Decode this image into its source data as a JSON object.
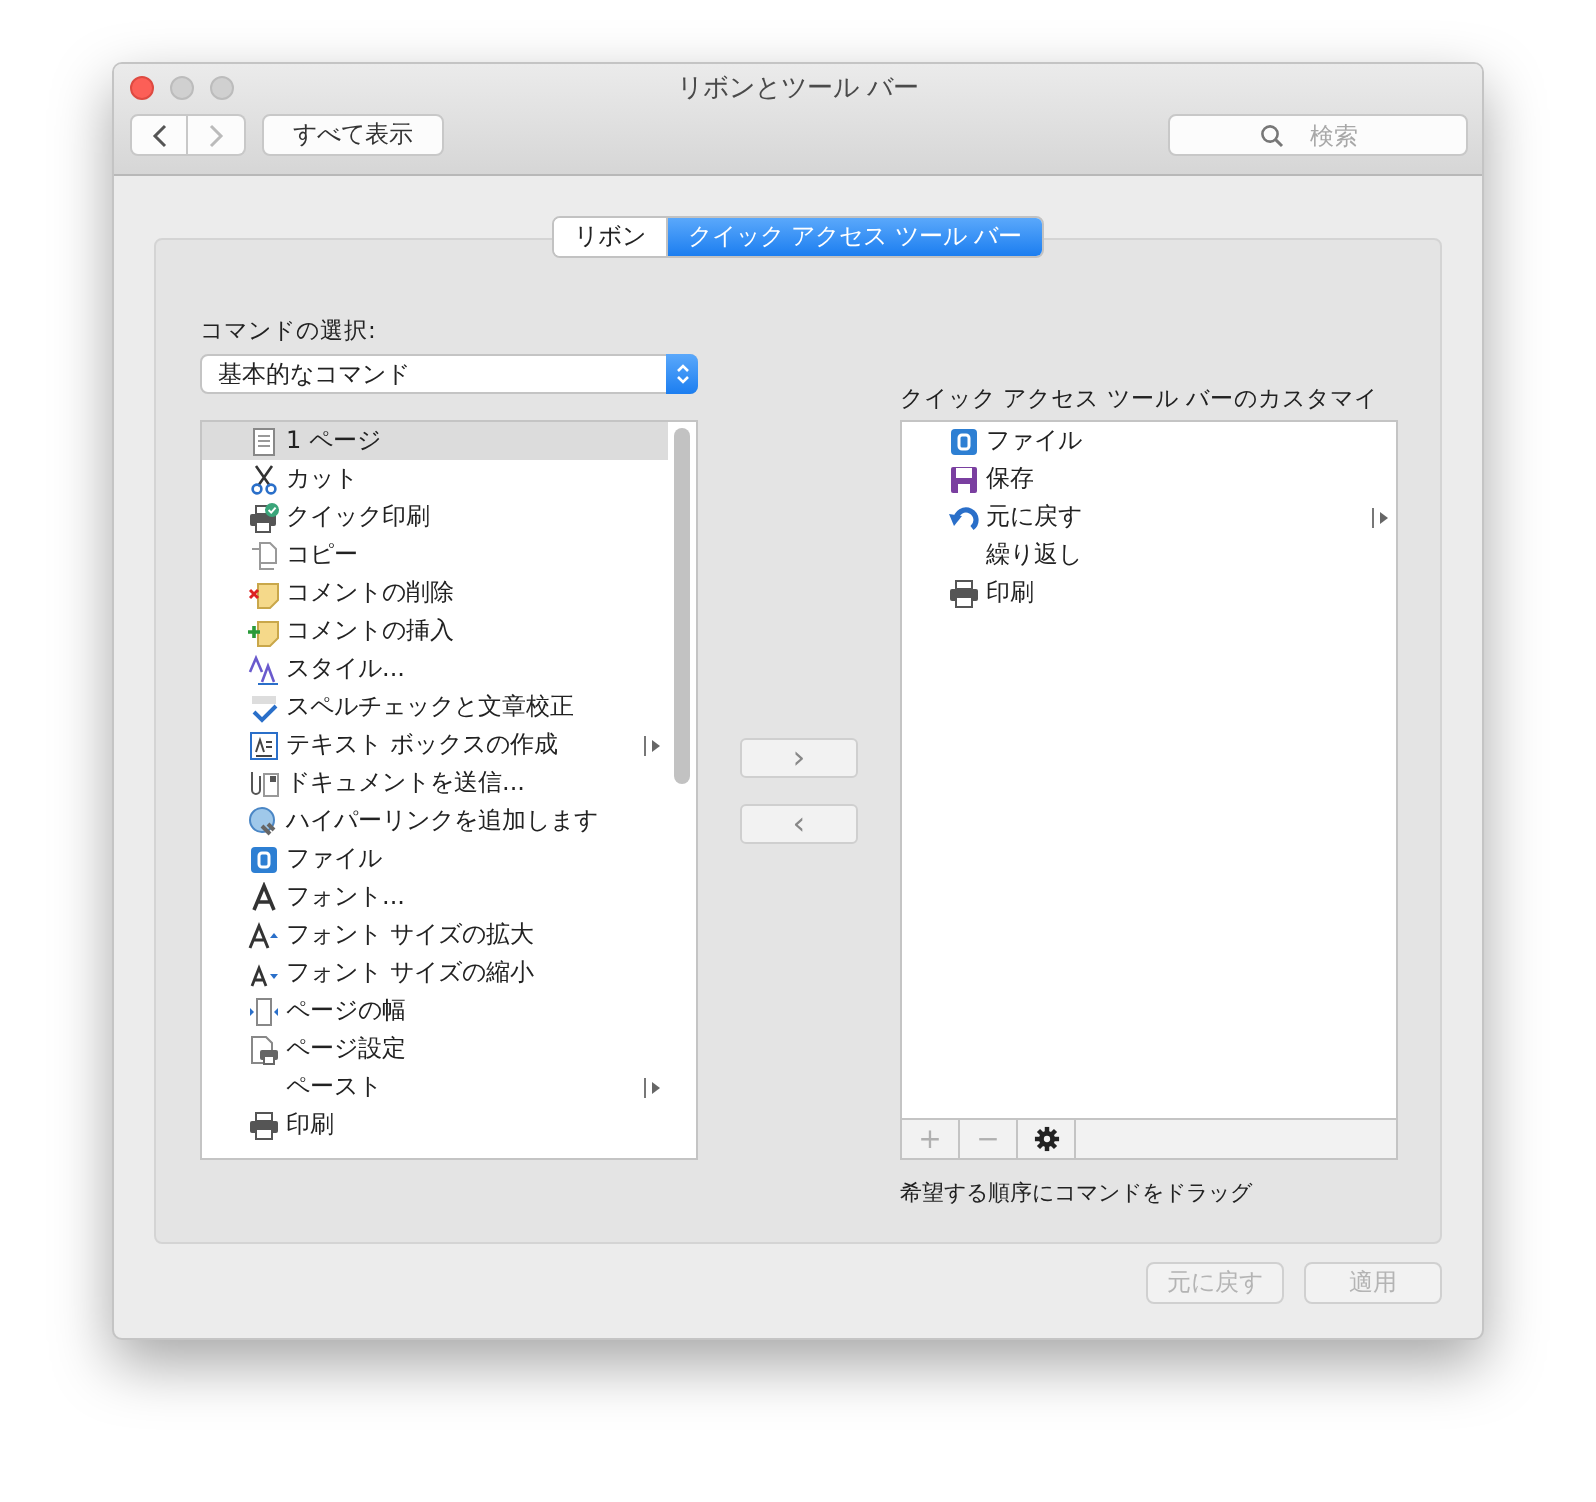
{
  "window": {
    "title": "リボンとツール バー"
  },
  "toolbar": {
    "show_all": "すべて表示",
    "search": {
      "placeholder": "検索"
    }
  },
  "tabs": [
    {
      "label": "リボン",
      "selected": false
    },
    {
      "label": "クイック アクセス ツール バー",
      "selected": true
    }
  ],
  "commands": {
    "label": "コマンドの選択:",
    "popup_value": "基本的なコマンド",
    "items": [
      {
        "label": "1 ページ",
        "selected": true,
        "submenu": false
      },
      {
        "label": "カット",
        "selected": false,
        "submenu": false
      },
      {
        "label": "クイック印刷",
        "selected": false,
        "submenu": false
      },
      {
        "label": "コピー",
        "selected": false,
        "submenu": false
      },
      {
        "label": "コメントの削除",
        "selected": false,
        "submenu": false
      },
      {
        "label": "コメントの挿入",
        "selected": false,
        "submenu": false
      },
      {
        "label": "スタイル...",
        "selected": false,
        "submenu": false
      },
      {
        "label": "スペルチェックと文章校正",
        "selected": false,
        "submenu": false
      },
      {
        "label": "テキスト ボックスの作成",
        "selected": false,
        "submenu": true
      },
      {
        "label": "ドキュメントを送信...",
        "selected": false,
        "submenu": false
      },
      {
        "label": "ハイパーリンクを追加します",
        "selected": false,
        "submenu": false
      },
      {
        "label": "ファイル",
        "selected": false,
        "submenu": false
      },
      {
        "label": "フォント...",
        "selected": false,
        "submenu": false
      },
      {
        "label": "フォント サイズの拡大",
        "selected": false,
        "submenu": false
      },
      {
        "label": "フォント サイズの縮小",
        "selected": false,
        "submenu": false
      },
      {
        "label": "ページの幅",
        "selected": false,
        "submenu": false
      },
      {
        "label": "ページ設定",
        "selected": false,
        "submenu": false
      },
      {
        "label": "ペースト",
        "selected": false,
        "submenu": true
      },
      {
        "label": "印刷",
        "selected": false,
        "submenu": false
      }
    ]
  },
  "move_buttons": {
    "add": "›",
    "remove": "‹"
  },
  "quick_access": {
    "label": "クイック アクセス ツール バーのカスタマイ",
    "items": [
      {
        "label": "ファイル",
        "selected": false,
        "submenu": false
      },
      {
        "label": "保存",
        "selected": false,
        "submenu": false
      },
      {
        "label": "元に戻す",
        "selected": false,
        "submenu": true
      },
      {
        "label": "繰り返し",
        "selected": false,
        "submenu": false
      },
      {
        "label": "印刷",
        "selected": false,
        "submenu": false
      }
    ],
    "plus": "+",
    "minus": "−",
    "hint": "希望する順序にコマンドをドラッグ"
  },
  "footer": {
    "buttons": [
      {
        "label": "元に戻す",
        "disabled": true
      },
      {
        "label": "適用",
        "disabled": true
      }
    ]
  }
}
